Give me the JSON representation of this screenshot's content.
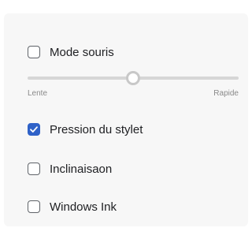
{
  "settings": {
    "mode_souris": {
      "label": "Mode souris",
      "checked": false
    },
    "speed": {
      "min_label": "Lente",
      "max_label": "Rapide",
      "value": 0.5
    },
    "pression": {
      "label": "Pression du stylet",
      "checked": true
    },
    "inclinaison": {
      "label": "Inclinaisaon",
      "checked": false
    },
    "windows_ink": {
      "label": "Windows Ink",
      "checked": false
    }
  },
  "colors": {
    "accent": "#2f62c8",
    "panel_background": "#f7f7f7",
    "track": "#d6d6d6"
  },
  "icons": {
    "check": "checkmark-icon"
  }
}
